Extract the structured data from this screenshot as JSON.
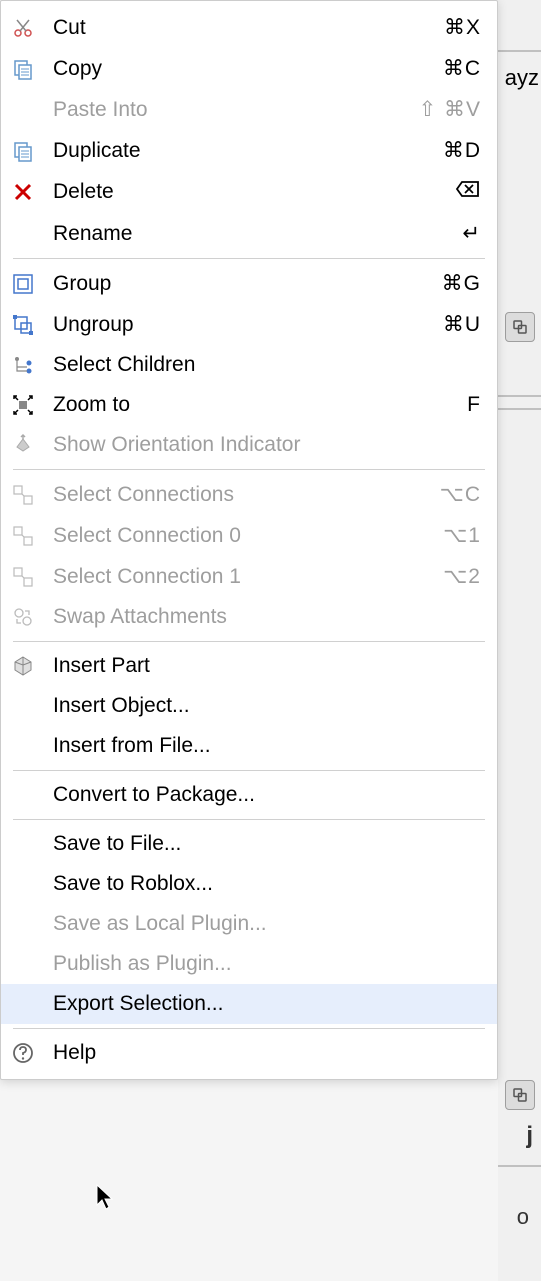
{
  "menu": {
    "cut": {
      "label": "Cut",
      "shortcut": "⌘X"
    },
    "copy": {
      "label": "Copy",
      "shortcut": "⌘C"
    },
    "paste_into": {
      "label": "Paste Into",
      "shortcut": "⇧ ⌘V"
    },
    "duplicate": {
      "label": "Duplicate",
      "shortcut": "⌘D"
    },
    "delete": {
      "label": "Delete",
      "shortcut": ""
    },
    "rename": {
      "label": "Rename",
      "shortcut": "↵"
    },
    "group": {
      "label": "Group",
      "shortcut": "⌘G"
    },
    "ungroup": {
      "label": "Ungroup",
      "shortcut": "⌘U"
    },
    "select_children": {
      "label": "Select Children",
      "shortcut": ""
    },
    "zoom_to": {
      "label": "Zoom to",
      "shortcut": "F"
    },
    "show_orientation": {
      "label": "Show Orientation Indicator",
      "shortcut": ""
    },
    "select_connections": {
      "label": "Select Connections",
      "shortcut": "⌥C"
    },
    "select_connection_0": {
      "label": "Select Connection 0",
      "shortcut": "⌥1"
    },
    "select_connection_1": {
      "label": "Select Connection 1",
      "shortcut": "⌥2"
    },
    "swap_attachments": {
      "label": "Swap Attachments",
      "shortcut": ""
    },
    "insert_part": {
      "label": "Insert Part",
      "shortcut": ""
    },
    "insert_object": {
      "label": "Insert Object...",
      "shortcut": ""
    },
    "insert_from_file": {
      "label": "Insert from File...",
      "shortcut": ""
    },
    "convert_to_package": {
      "label": "Convert to Package...",
      "shortcut": ""
    },
    "save_to_file": {
      "label": "Save to File...",
      "shortcut": ""
    },
    "save_to_roblox": {
      "label": "Save to Roblox...",
      "shortcut": ""
    },
    "save_as_local_plugin": {
      "label": "Save as Local Plugin...",
      "shortcut": ""
    },
    "publish_as_plugin": {
      "label": "Publish as Plugin...",
      "shortcut": ""
    },
    "export_selection": {
      "label": "Export Selection...",
      "shortcut": ""
    },
    "help": {
      "label": "Help",
      "shortcut": ""
    }
  },
  "background": {
    "text_partial_1": "ayz",
    "text_partial_2": "j",
    "text_partial_3": "o"
  }
}
